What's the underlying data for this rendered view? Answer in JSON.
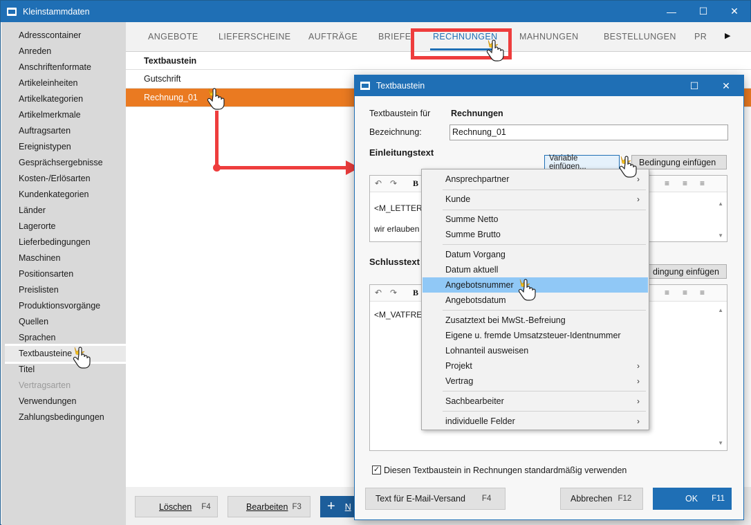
{
  "window": {
    "title": "Kleinstammdaten"
  },
  "sidebar": {
    "items": [
      {
        "label": "Adresscontainer",
        "state": "normal"
      },
      {
        "label": "Anreden",
        "state": "normal"
      },
      {
        "label": "Anschriftenformate",
        "state": "normal"
      },
      {
        "label": "Artikeleinheiten",
        "state": "normal"
      },
      {
        "label": "Artikelkategorien",
        "state": "normal"
      },
      {
        "label": "Artikelmerkmale",
        "state": "normal"
      },
      {
        "label": "Auftragsarten",
        "state": "normal"
      },
      {
        "label": "Ereignistypen",
        "state": "normal"
      },
      {
        "label": "Gesprächsergebnisse",
        "state": "normal"
      },
      {
        "label": "Kosten-/Erlösarten",
        "state": "normal"
      },
      {
        "label": "Kundenkategorien",
        "state": "normal"
      },
      {
        "label": "Länder",
        "state": "normal"
      },
      {
        "label": "Lagerorte",
        "state": "normal"
      },
      {
        "label": "Lieferbedingungen",
        "state": "normal"
      },
      {
        "label": "Maschinen",
        "state": "normal"
      },
      {
        "label": "Positionsarten",
        "state": "normal"
      },
      {
        "label": "Preislisten",
        "state": "normal"
      },
      {
        "label": "Produktionsvorgänge",
        "state": "normal"
      },
      {
        "label": "Quellen",
        "state": "normal"
      },
      {
        "label": "Sprachen",
        "state": "normal"
      },
      {
        "label": "Textbausteine",
        "state": "selected"
      },
      {
        "label": "Titel",
        "state": "normal"
      },
      {
        "label": "Vertragsarten",
        "state": "disabled"
      },
      {
        "label": "Verwendungen",
        "state": "normal"
      },
      {
        "label": "Zahlungsbedingungen",
        "state": "normal"
      }
    ]
  },
  "tabs": [
    {
      "label": "ANGEBOTE"
    },
    {
      "label": "LIEFERSCHEINE"
    },
    {
      "label": "AUFTRÄGE"
    },
    {
      "label": "BRIEFE"
    },
    {
      "label": "RECHNUNGEN",
      "active": true
    },
    {
      "label": "MAHNUNGEN"
    },
    {
      "label": "BESTELLUNGEN"
    },
    {
      "label": "PR"
    }
  ],
  "list": {
    "header": "Textbaustein",
    "rows": [
      "Gutschrift",
      "Rechnung_01"
    ]
  },
  "bottom": {
    "delete_label": "Löschen",
    "delete_key": "F4",
    "edit_label": "Bearbeiten",
    "edit_key": "F3",
    "new_label": "N"
  },
  "dialog": {
    "title": "Textbaustein",
    "for_label": "Textbaustein für",
    "for_value": "Rechnungen",
    "name_label": "Bezeichnung:",
    "name_value": "Rechnung_01",
    "intro_title": "Einleitungstext",
    "insert_variable": "Variable einfügen...",
    "insert_condition": "Bedingung einfügen",
    "insert_condition_2": "dingung einfügen",
    "intro_line1": "<M_LETTER",
    "intro_line2": "wir erlauben",
    "closing_title": "Schlusstext",
    "closing_line1": "<M_VATFRE",
    "checkbox_label": "Diesen Textbaustein in Rechnungen standardmäßig verwenden",
    "checkbox_checked": true,
    "email_btn": "Text für E-Mail-Versand",
    "email_key": "F4",
    "cancel_btn": "Abbrechen",
    "cancel_key": "F12",
    "ok_btn": "OK",
    "ok_key": "F11"
  },
  "context_menu": {
    "items": [
      {
        "label": "Ansprechpartner",
        "submenu": true
      },
      {
        "label": "Kunde",
        "submenu": true
      },
      {
        "label": "Summe Netto",
        "submenu": false
      },
      {
        "label": "Summe Brutto",
        "submenu": false
      },
      {
        "label": "Datum Vorgang",
        "submenu": false
      },
      {
        "label": "Datum aktuell",
        "submenu": false
      },
      {
        "label": "Angebotsnummer",
        "submenu": false,
        "highlighted": true
      },
      {
        "label": "Angebotsdatum",
        "submenu": false
      },
      {
        "label": "Zusatztext bei MwSt.-Befreiung",
        "submenu": false
      },
      {
        "label": "Eigene u. fremde Umsatzsteuer-Identnummer",
        "submenu": false
      },
      {
        "label": "Lohnanteil ausweisen",
        "submenu": false
      },
      {
        "label": "Projekt",
        "submenu": true
      },
      {
        "label": "Vertrag",
        "submenu": true
      },
      {
        "label": "Sachbearbeiter",
        "submenu": true
      },
      {
        "label": "individuelle Felder",
        "submenu": true
      }
    ]
  },
  "colors": {
    "accent": "#1f6fb5",
    "selection": "#ea7a21",
    "annotation": "#ee3d3d",
    "menu_highlight": "#90c8f6"
  },
  "icons": {
    "minimize": "minimize-icon",
    "maximize": "maximize-icon",
    "close": "close-icon",
    "submenu": "chevron-right-icon",
    "cursor": "hand-cursor-icon"
  }
}
